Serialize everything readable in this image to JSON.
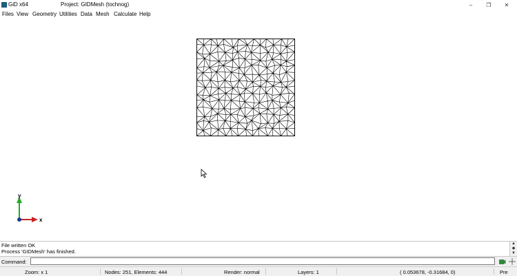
{
  "window": {
    "app_title": "GiD x64",
    "project_title": "Project: GIDMesh (tochnog)",
    "minimize_glyph": "–",
    "restore_glyph": "❐",
    "close_glyph": "✕"
  },
  "menu": [
    "Files",
    "View",
    "Geometry",
    "Utilities",
    "Data",
    "Mesh",
    "Calculate",
    "Help"
  ],
  "axes": {
    "x_label": "x",
    "y_label": "y"
  },
  "log": {
    "lines": [
      "File written OK",
      "Process 'GIDMesh' has finished."
    ]
  },
  "command": {
    "label": "Command:",
    "value": ""
  },
  "status": {
    "zoom": "Zoom: x 1",
    "nodes_elements": "Nodes: 251, Elements: 444",
    "render": "Render: normal",
    "layers": "Layers: 1",
    "coords": "( 0.053678, -0.31684,  0)",
    "mode": "Pre"
  },
  "colors": {
    "axis_x": "#cc2222",
    "axis_y": "#22aa22",
    "axis_z": "#1a3a8a",
    "mesh": "#000000"
  }
}
